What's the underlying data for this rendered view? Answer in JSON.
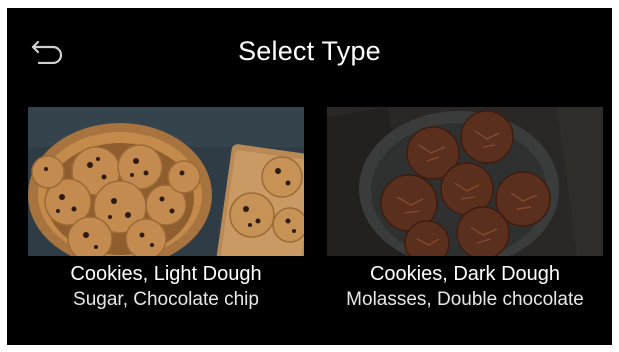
{
  "header": {
    "title": "Select Type",
    "back_icon": "back-arrow-icon"
  },
  "options": [
    {
      "name": "Cookies, Light Dough",
      "description": "Sugar, Chocolate chip",
      "image": "light-cookies-photo"
    },
    {
      "name": "Cookies, Dark Dough",
      "description": "Molasses, Double chocolate",
      "image": "dark-cookies-photo"
    }
  ],
  "colors": {
    "background": "#000000",
    "text": "#ffffff"
  }
}
